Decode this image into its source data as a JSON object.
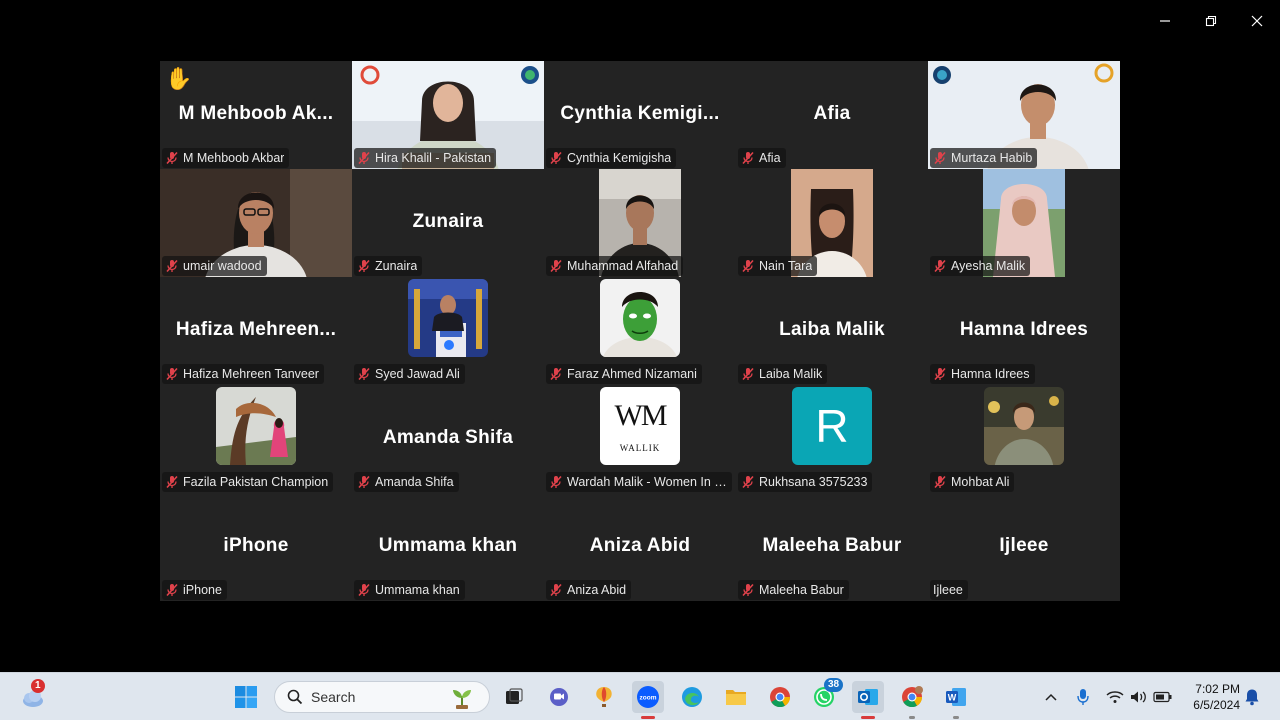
{
  "meeting": {
    "tiles": [
      {
        "id": "t1",
        "big": "M  Mehboob  Ak...",
        "label": "M Mehboob Akbar",
        "muted": true,
        "hand": true,
        "video": null
      },
      {
        "id": "t2",
        "big": "",
        "label": "Hira Khalil - Pakistan",
        "muted": true,
        "video": "hira"
      },
      {
        "id": "t3",
        "big": "Cynthia  Kemigi...",
        "label": "Cynthia Kemigisha",
        "muted": true,
        "video": null
      },
      {
        "id": "t4",
        "big": "Afia",
        "label": "Afia",
        "muted": true,
        "video": null
      },
      {
        "id": "t5",
        "big": "",
        "label": "Murtaza Habib",
        "muted": true,
        "video": "murtaza",
        "speaking": true
      },
      {
        "id": "t6",
        "big": "",
        "label": "umair wadood",
        "muted": true,
        "video": "umair"
      },
      {
        "id": "t7",
        "big": "Zunaira",
        "label": "Zunaira",
        "muted": true,
        "video": null
      },
      {
        "id": "t8",
        "big": "",
        "label": "Muhammad Alfahad",
        "muted": true,
        "video": "alfahad"
      },
      {
        "id": "t9",
        "big": "",
        "label": "Nain Tara",
        "muted": true,
        "video": "nain"
      },
      {
        "id": "t10",
        "big": "",
        "label": "Ayesha Malik",
        "muted": true,
        "video": "ayesha"
      },
      {
        "id": "t11",
        "big": "Hafiza  Mehreen...",
        "label": "Hafiza Mehreen Tanveer",
        "muted": true,
        "video": null
      },
      {
        "id": "t12",
        "big": "",
        "label": "Syed Jawad Ali",
        "muted": true,
        "video": "jawad"
      },
      {
        "id": "t13",
        "big": "",
        "label": "Faraz Ahmed Nizamani",
        "muted": true,
        "video": "faraz"
      },
      {
        "id": "t14",
        "big": "Laiba Malik",
        "label": "Laiba Malik",
        "muted": true,
        "video": null
      },
      {
        "id": "t15",
        "big": "Hamna Idrees",
        "label": "Hamna Idrees",
        "muted": true,
        "video": null
      },
      {
        "id": "t16",
        "big": "",
        "label": "Fazila Pakistan Champion",
        "muted": true,
        "video": "fazila"
      },
      {
        "id": "t17",
        "big": "Amanda Shifa",
        "label": "Amanda Shifa",
        "muted": true,
        "video": null
      },
      {
        "id": "t18",
        "big": "",
        "label": "Wardah Malik - Women In C...",
        "muted": true,
        "video": "wardah"
      },
      {
        "id": "t19",
        "big": "",
        "label": "Rukhsana 3575233",
        "muted": true,
        "video": "rukhsana"
      },
      {
        "id": "t20",
        "big": "",
        "label": "Mohbat Ali",
        "muted": true,
        "video": "mohbat"
      },
      {
        "id": "t21",
        "big": "iPhone",
        "label": "iPhone",
        "muted": true,
        "video": null
      },
      {
        "id": "t22",
        "big": "Ummama khan",
        "label": "Ummama khan",
        "muted": true,
        "video": null
      },
      {
        "id": "t23",
        "big": "Aniza Abid",
        "label": "Aniza Abid",
        "muted": true,
        "video": null
      },
      {
        "id": "t24",
        "big": "Maleeha Babur",
        "label": "Maleeha Babur",
        "muted": true,
        "video": null
      },
      {
        "id": "t25",
        "big": "Ijleee",
        "label": "Ijleee",
        "muted": false,
        "video": null
      }
    ],
    "avatar_letter": "R",
    "wardah_logo_text": "WM",
    "wardah_logo_sub": "WALLIK"
  },
  "taskbar": {
    "search_placeholder": "Search",
    "weather_badge": "1",
    "whatsapp_badge": "38",
    "time": "7:02 PM",
    "date": "6/5/2024"
  },
  "colors": {
    "tile_bg": "#232323",
    "speaking_border": "#2ed47a",
    "mic_off": "#e0424b",
    "zoom_blue": "#0b5cff",
    "avatar_teal": "#0aa6b5"
  }
}
